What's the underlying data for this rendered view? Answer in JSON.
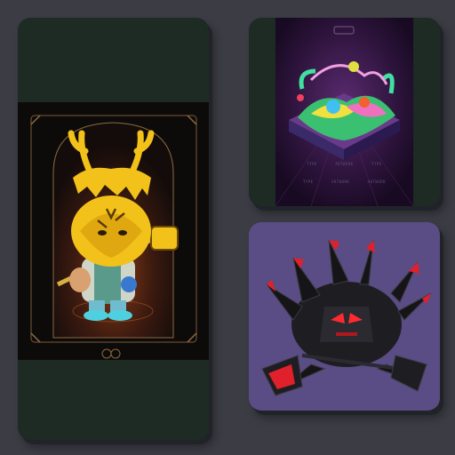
{
  "gallery": {
    "background": "#3b3c44",
    "cards": [
      {
        "id": "card-left",
        "subject": "yellow-antlered-tiger-mask-character",
        "accent": "#f2c21a",
        "background": "#1e2a24"
      },
      {
        "id": "card-top",
        "subject": "psychedelic-isometric-island",
        "accent": "#7a3c8c",
        "background": "#1e2a24",
        "caption_rows": [
          [
            "TYPE",
            "ARTWORK",
            "TYPE"
          ],
          [
            "TYPE",
            "ARTWORK",
            "ARTWORK"
          ]
        ]
      },
      {
        "id": "card-bottom",
        "subject": "black-red-spiked-monster",
        "accent": "#e0202a",
        "background": "#5a4c84"
      }
    ]
  }
}
